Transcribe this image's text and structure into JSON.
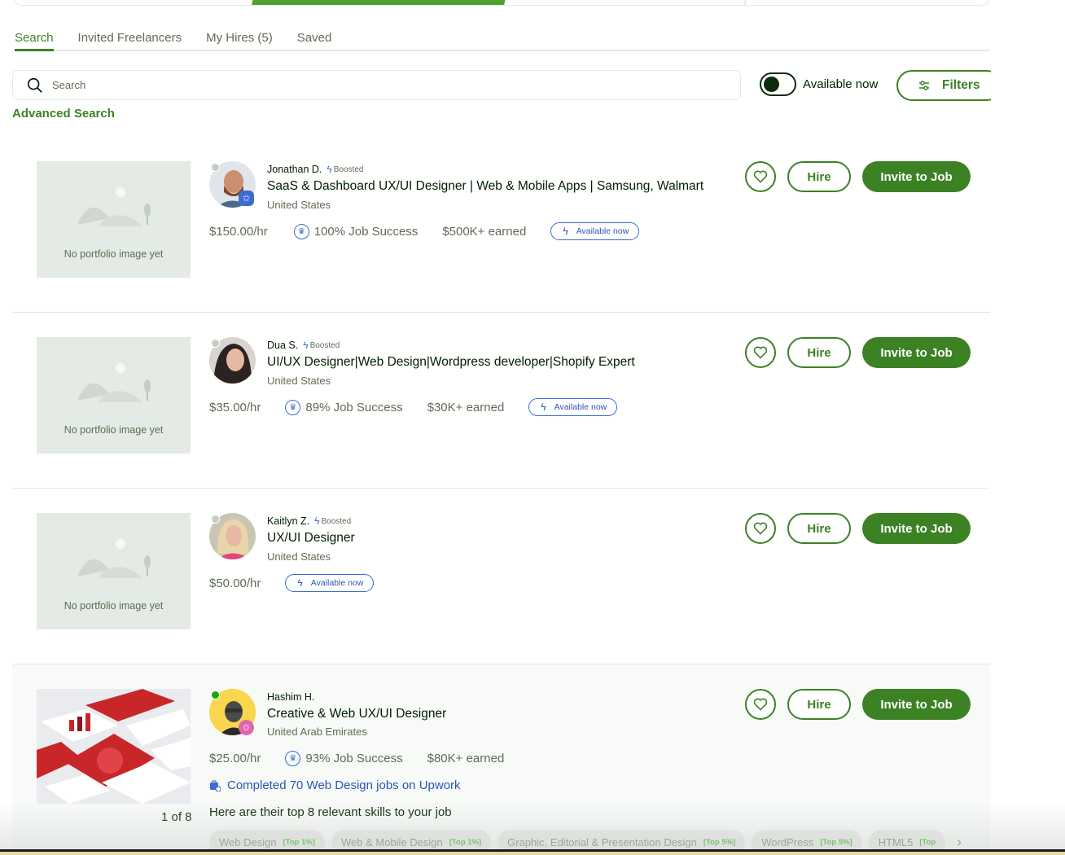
{
  "tabs": [
    {
      "label": "Search",
      "active": true
    },
    {
      "label": "Invited Freelancers",
      "active": false
    },
    {
      "label": "My Hires (5)",
      "active": false
    },
    {
      "label": "Saved",
      "active": false
    }
  ],
  "search": {
    "placeholder": "Search",
    "value": ""
  },
  "available_toggle": {
    "label": "Available now",
    "on": true
  },
  "filters_label": "Filters",
  "advanced_search_label": "Advanced Search",
  "colors": {
    "brand_green": "#3c8224",
    "link_blue": "#2b55b6",
    "online_green": "#14a800"
  },
  "actions": {
    "hire_label": "Hire",
    "invite_label": "Invite to Job"
  },
  "freelancers": [
    {
      "name": "Jonathan D.",
      "boosted": "Boosted",
      "headline": "SaaS & Dashboard UX/UI Designer | Web & Mobile Apps | Samsung, Walmart",
      "country": "United States",
      "rate": "$150.00/hr",
      "job_success": "100% Job Success",
      "earned": "$500K+ earned",
      "available": "Available now",
      "portfolio_placeholder": "No portfolio image yet",
      "online": false
    },
    {
      "name": "Dua S.",
      "boosted": "Boosted",
      "headline": "UI/UX Designer|Web Design|Wordpress developer|Shopify Expert",
      "country": "United States",
      "rate": "$35.00/hr",
      "job_success": "89% Job Success",
      "earned": "$30K+ earned",
      "available": "Available now",
      "portfolio_placeholder": "No portfolio image yet",
      "online": false
    },
    {
      "name": "Kaitlyn Z.",
      "boosted": "Boosted",
      "headline": "UX/UI Designer",
      "country": "United States",
      "rate": "$50.00/hr",
      "available": "Available now",
      "portfolio_placeholder": "No portfolio image yet",
      "online": false
    },
    {
      "name": "Hashim H.",
      "headline": "Creative & Web UX/UI Designer",
      "country": "United Arab Emirates",
      "rate": "$25.00/hr",
      "job_success": "93% Job Success",
      "earned": "$80K+ earned",
      "completed": "Completed 70 Web Design jobs on Upwork",
      "skills_intro": "Here are their top 8 relevant skills to your job",
      "portfolio_counter": "1 of 8",
      "online": true,
      "skills": [
        {
          "name": "Web Design",
          "tier": "[Top 1%]"
        },
        {
          "name": "Web & Mobile Design",
          "tier": "[Top 1%]"
        },
        {
          "name": "Graphic, Editorial & Presentation Design",
          "tier": "[Top 5%]"
        },
        {
          "name": "WordPress",
          "tier": "[Top 5%]"
        },
        {
          "name": "HTML5",
          "tier": "[Top"
        }
      ]
    }
  ]
}
